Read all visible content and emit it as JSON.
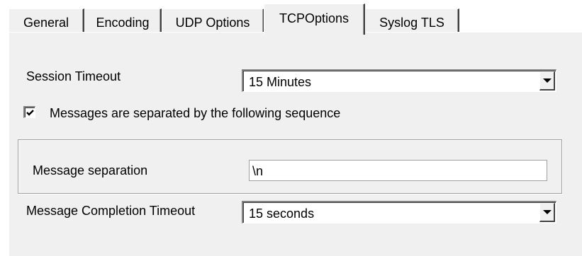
{
  "tabs": [
    {
      "label": "General",
      "active": false
    },
    {
      "label": "Encoding",
      "active": false
    },
    {
      "label": "UDP Options",
      "active": false
    },
    {
      "label": "TCPOptions",
      "active": true
    },
    {
      "label": "Syslog TLS",
      "active": false
    }
  ],
  "session_timeout": {
    "label": "Session Timeout",
    "value": "15 Minutes"
  },
  "separator_checkbox": {
    "label": "Messages are separated by the following sequence",
    "checked": true
  },
  "message_separation": {
    "label": "Message separation",
    "value": "\\n"
  },
  "completion_timeout": {
    "label": "Message Completion Timeout",
    "value": "15 seconds"
  },
  "icons": {
    "combo_arrow": "chevron-down-icon",
    "check": "checkmark-icon"
  }
}
